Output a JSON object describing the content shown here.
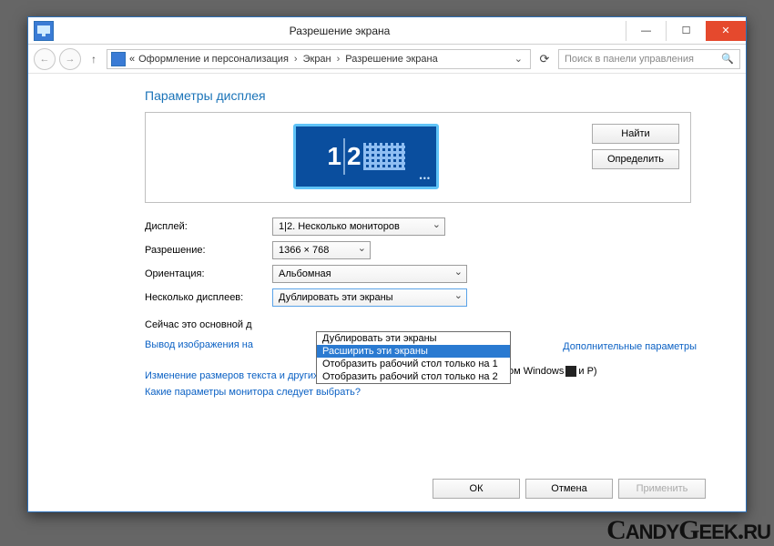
{
  "window": {
    "title": "Разрешение экрана",
    "minimize": "—",
    "maximize": "☐",
    "close": "✕"
  },
  "nav": {
    "back": "←",
    "forward": "→",
    "up": "↑",
    "breadcrumb_prefix": "«",
    "breadcrumb": [
      "Оформление и персонализация",
      "Экран",
      "Разрешение экрана"
    ],
    "refresh": "⟳",
    "search_placeholder": "Поиск в панели управления"
  },
  "page": {
    "heading": "Параметры дисплея",
    "detect": "Найти",
    "identify": "Определить",
    "monitors": "1|2",
    "labels": {
      "display": "Дисплей:",
      "resolution": "Разрешение:",
      "orientation": "Ориентация:",
      "multiple": "Несколько дисплеев:"
    },
    "values": {
      "display": "1|2. Несколько мониторов",
      "resolution": "1366 × 768",
      "orientation": "Альбомная",
      "multiple": "Дублировать эти экраны"
    },
    "dropdown_options": [
      "Дублировать эти экраны",
      "Расширить эти экраны",
      "Отобразить рабочий стол только на 1",
      "Отобразить рабочий стол только на 2"
    ],
    "dropdown_selected_index": 1,
    "primary_text_left": "Сейчас это основной д",
    "advanced_link": "Дополнительные параметры",
    "project_line_left": "Вывод изображения на",
    "project_line_right": "отипом Windows",
    "project_line_tail": " и P)",
    "text_size_link": "Изменение размеров текста и других элементов",
    "which_settings_link": "Какие параметры монитора следует выбрать?",
    "ok": "ОК",
    "cancel": "Отмена",
    "apply": "Применить"
  },
  "watermark": "CandyGeek.ru"
}
